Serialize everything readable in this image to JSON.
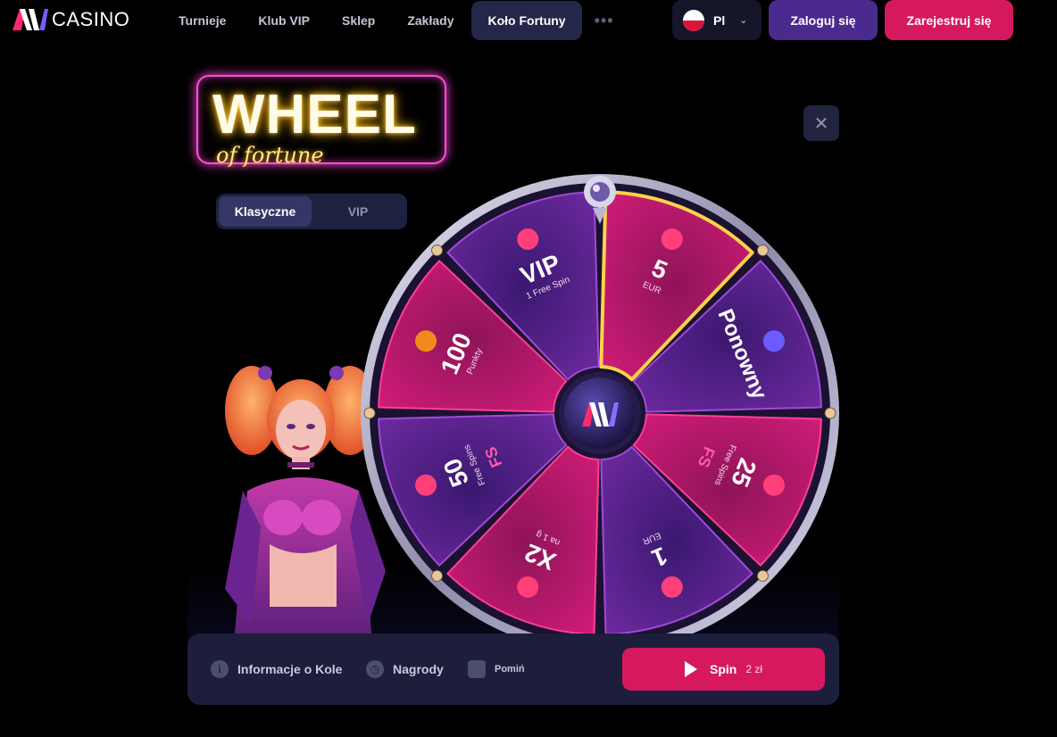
{
  "header": {
    "logo_text": "CASINO",
    "nav": [
      {
        "label": "Turnieje"
      },
      {
        "label": "Klub VIP"
      },
      {
        "label": "Sklep"
      },
      {
        "label": "Zakłady"
      },
      {
        "label": "Koło Fortuny",
        "active": true
      }
    ],
    "more_label": "•••",
    "language": {
      "code": "Pl",
      "flag": "poland-flag"
    },
    "login_label": "Zaloguj się",
    "register_label": "Zarejestruj się"
  },
  "modal": {
    "logo_title": "WHEEL",
    "logo_subtitle": "of fortune",
    "close_icon": "close-icon",
    "tabs": [
      {
        "label": "Klasyczne",
        "active": true
      },
      {
        "label": "VIP",
        "active": false
      }
    ],
    "wheel": {
      "center_logo": "AV",
      "segments": [
        {
          "main": "5",
          "sub": "EUR",
          "icon": "gem-icon"
        },
        {
          "main": "Ponowny",
          "sub": "",
          "icon": "refresh-icon"
        },
        {
          "main": "25",
          "sub": "Free Spins",
          "icon": "fs-icon",
          "badge": "FS"
        },
        {
          "main": "1",
          "sub": "EUR",
          "icon": "gem-icon"
        },
        {
          "main": "X2",
          "sub": "na 1 g",
          "icon": "gem-icon"
        },
        {
          "main": "50",
          "sub": "Free Spins",
          "icon": "fs-icon",
          "badge": "FS"
        },
        {
          "main": "100",
          "sub": "Punkty",
          "icon": "coin-icon"
        },
        {
          "main": "VIP",
          "sub": "1 Free Spin",
          "icon": "vip-wheel-icon"
        }
      ]
    },
    "bottom": {
      "info_label": "Informacje o Kole",
      "prizes_label": "Nagrody",
      "skip_label": "Pomiń",
      "spin_label": "Spin",
      "spin_price": "2 zł"
    }
  },
  "colors": {
    "accent_pink": "#d6195e",
    "accent_purple": "#4b2a8e",
    "segment_pink": "#b8166b",
    "segment_purple": "#5a1f8f"
  }
}
